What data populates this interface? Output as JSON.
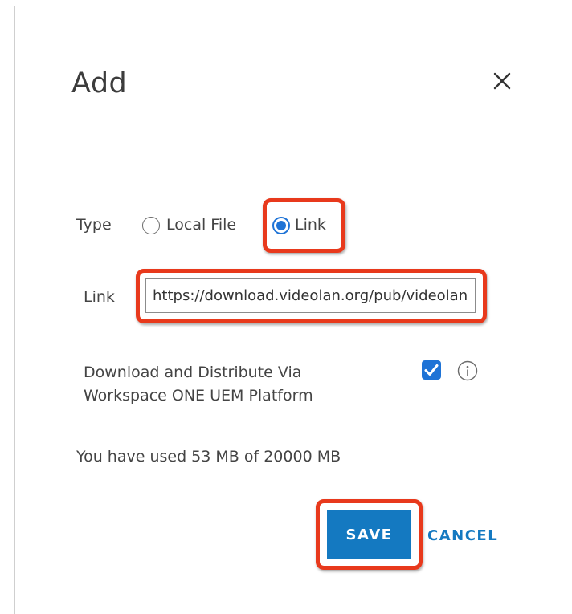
{
  "dialog": {
    "title": "Add"
  },
  "type_field": {
    "label": "Type",
    "options": [
      {
        "label": "Local File",
        "selected": false
      },
      {
        "label": "Link",
        "selected": true
      }
    ]
  },
  "link_field": {
    "label": "Link",
    "value": "https://download.videolan.org/pub/videolan/vlc/"
  },
  "distribute": {
    "label_line1": "Download and Distribute Via",
    "label_line2": "Workspace ONE UEM Platform",
    "checked": true
  },
  "storage": {
    "usage_text": "You have used 53 MB of 20000 MB"
  },
  "actions": {
    "save_label": "SAVE",
    "cancel_label": "CANCEL"
  },
  "colors": {
    "accent": "#1479c1",
    "radio_selected": "#1e73d6",
    "highlight": "#e8391c"
  },
  "icons": {
    "close": "close-icon",
    "info": "info-icon"
  }
}
